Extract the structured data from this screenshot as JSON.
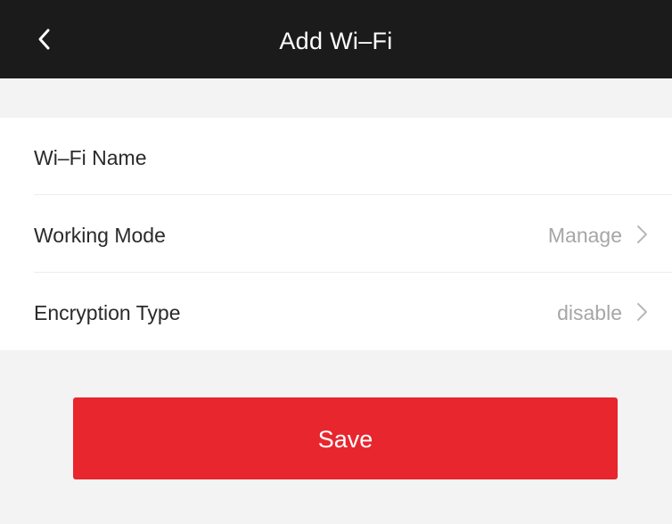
{
  "header": {
    "title": "Add Wi–Fi",
    "back_icon": "chevron-left-icon"
  },
  "form": {
    "rows": [
      {
        "label": "Wi–Fi Name",
        "value": ""
      },
      {
        "label": "Working Mode",
        "value": "Manage",
        "icon": "chevron-right-icon"
      },
      {
        "label": "Encryption Type",
        "value": "disable",
        "icon": "chevron-right-icon"
      }
    ]
  },
  "actions": {
    "save_label": "Save"
  },
  "colors": {
    "header_bg": "#1b1b1b",
    "page_bg": "#f3f3f3",
    "accent": "#e8262d",
    "value_text": "#a6a6a6"
  }
}
